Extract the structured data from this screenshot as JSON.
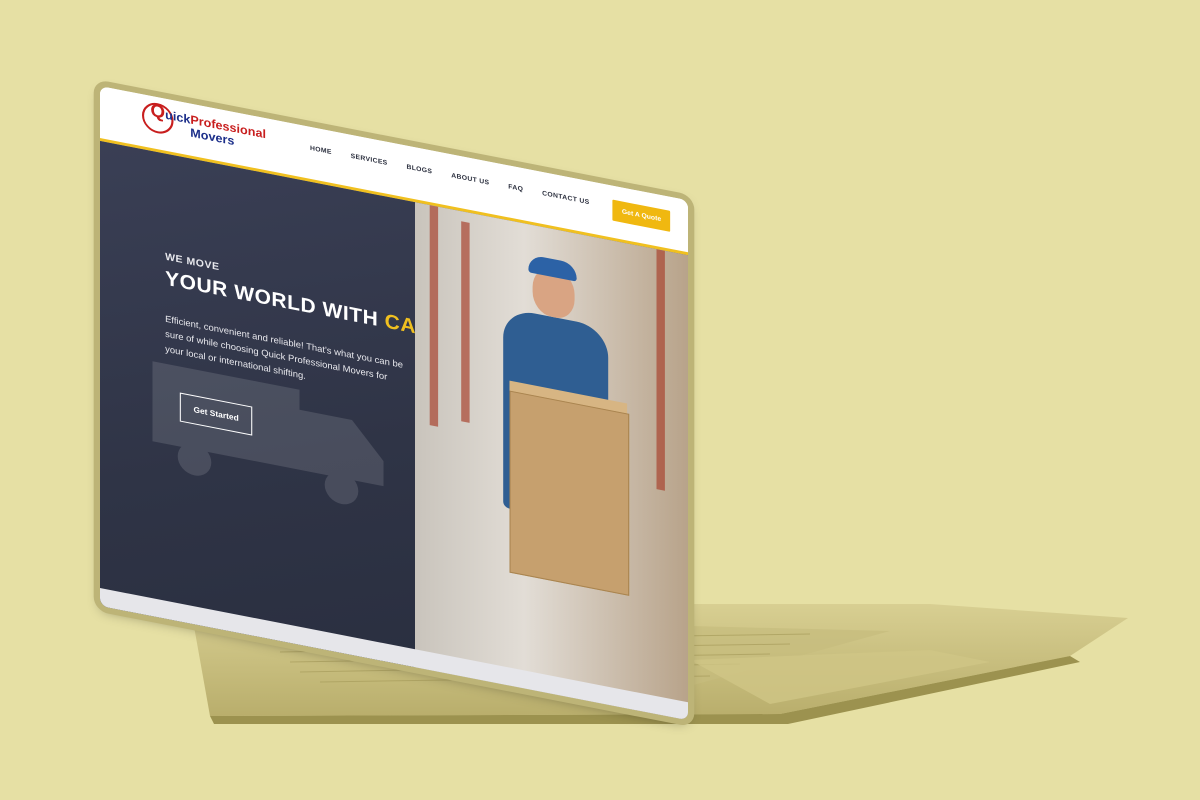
{
  "page": {
    "background_color": "#e6e0a4"
  },
  "site": {
    "logo": {
      "text_q": "Q",
      "text_line1_a": "uick",
      "text_line1_b": "Professional",
      "text_line2": "Movers"
    },
    "nav": [
      "HOME",
      "SERVICES",
      "BLOGS",
      "ABOUT US",
      "FAQ",
      "CONTACT US"
    ],
    "quote_button": "Get A Quote",
    "hero": {
      "kicker": "WE MOVE",
      "headline_main": "YOUR WORLD WITH ",
      "headline_accent": "CARE",
      "description": "Efficient, convenient and reliable! That's what you can be sure of while choosing Quick Professional Movers for your local or international shifting.",
      "cta": "Get Started"
    },
    "colors": {
      "accent": "#f0c020",
      "hero_bg": "#353a4e",
      "brand_red": "#c81e1e",
      "brand_blue": "#1c2f8a"
    }
  },
  "icons": {
    "logo_mark": "globe-pin-icon",
    "hero_graphic": "truck-icon"
  }
}
